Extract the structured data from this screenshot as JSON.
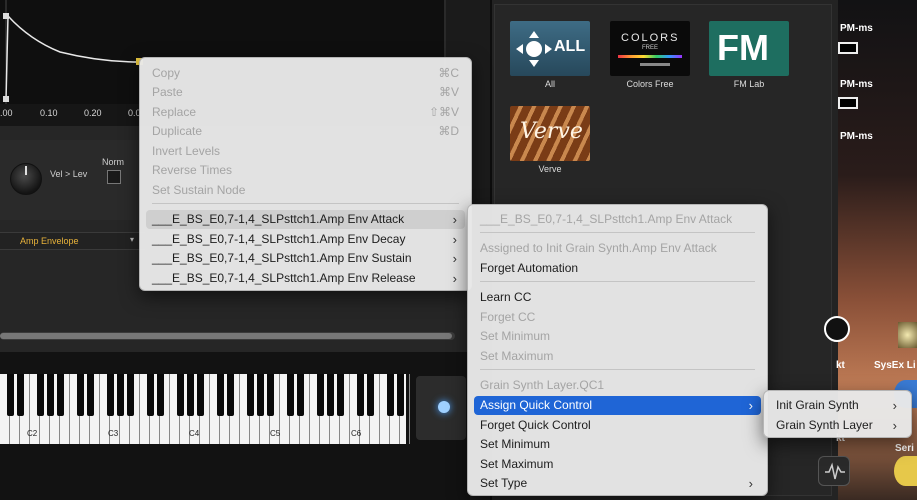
{
  "envelope": {
    "axis_ticks": [
      ".00",
      "0.10",
      "0.20",
      "0.0"
    ]
  },
  "controls": {
    "vel_label": "Vel > Lev",
    "norm_label": "Norm",
    "amp_env_label": "Amp Envelope",
    "caret": "▾"
  },
  "keyboard": {
    "octaves": [
      "C2",
      "C3",
      "C4",
      "C5",
      "C6"
    ]
  },
  "browser": {
    "libraries": [
      {
        "name": "All",
        "tile_text": "ALL",
        "icon": "move-arrows-icon"
      },
      {
        "name": "Colors Free",
        "tile_text": "COLORS",
        "tile_sub": "FREE"
      },
      {
        "name": "FM Lab",
        "tile_text": "FM"
      },
      {
        "name": "Verve",
        "tile_text": "Verve"
      }
    ]
  },
  "desktop": {
    "labels": [
      "PM-ms",
      "PM-ms",
      "PM-ms",
      "kt",
      "SysEx Li",
      "kt",
      "Seri"
    ]
  },
  "menu1": {
    "items": [
      {
        "label": "Copy",
        "shortcut": "⌘C",
        "disabled": true
      },
      {
        "label": "Paste",
        "shortcut": "⌘V",
        "disabled": true
      },
      {
        "label": "Replace",
        "shortcut": "⇧⌘V",
        "disabled": true
      },
      {
        "label": "Duplicate",
        "shortcut": "⌘D",
        "disabled": true
      },
      {
        "label": "Invert Levels",
        "shortcut": "",
        "disabled": true
      },
      {
        "label": "Reverse Times",
        "shortcut": "",
        "disabled": true
      },
      {
        "label": "Set Sustain Node",
        "shortcut": "",
        "disabled": true
      },
      {
        "label": "___E_BS_E0,7-1,4_SLPsttch1.Amp Env Attack",
        "submenu": true
      },
      {
        "label": "___E_BS_E0,7-1,4_SLPsttch1.Amp Env Decay",
        "submenu": true
      },
      {
        "label": "___E_BS_E0,7-1,4_SLPsttch1.Amp Env Sustain",
        "submenu": true
      },
      {
        "label": "___E_BS_E0,7-1,4_SLPsttch1.Amp Env Release",
        "submenu": true
      }
    ]
  },
  "menu2": {
    "items": [
      {
        "label": "___E_BS_E0,7-1,4_SLPsttch1.Amp Env Attack",
        "disabled": true
      },
      {
        "label": "Assigned to Init Grain Synth.Amp Env Attack",
        "disabled": true
      },
      {
        "label": "Forget Automation"
      },
      {
        "label": "Learn CC"
      },
      {
        "label": "Forget CC",
        "disabled": true
      },
      {
        "label": "Set Minimum",
        "disabled": true
      },
      {
        "label": "Set Maximum",
        "disabled": true
      },
      {
        "label": "Grain Synth Layer.QC1",
        "disabled": true
      },
      {
        "label": "Assign Quick Control",
        "submenu": true,
        "highlighted": true
      },
      {
        "label": "Forget Quick Control"
      },
      {
        "label": "Set Minimum"
      },
      {
        "label": "Set Maximum"
      },
      {
        "label": "Set Type",
        "submenu": true
      }
    ]
  },
  "menu3": {
    "items": [
      {
        "label": "Init Grain Synth",
        "submenu": true
      },
      {
        "label": "Grain Synth Layer",
        "submenu": true
      }
    ]
  },
  "arrow_glyph": "›"
}
